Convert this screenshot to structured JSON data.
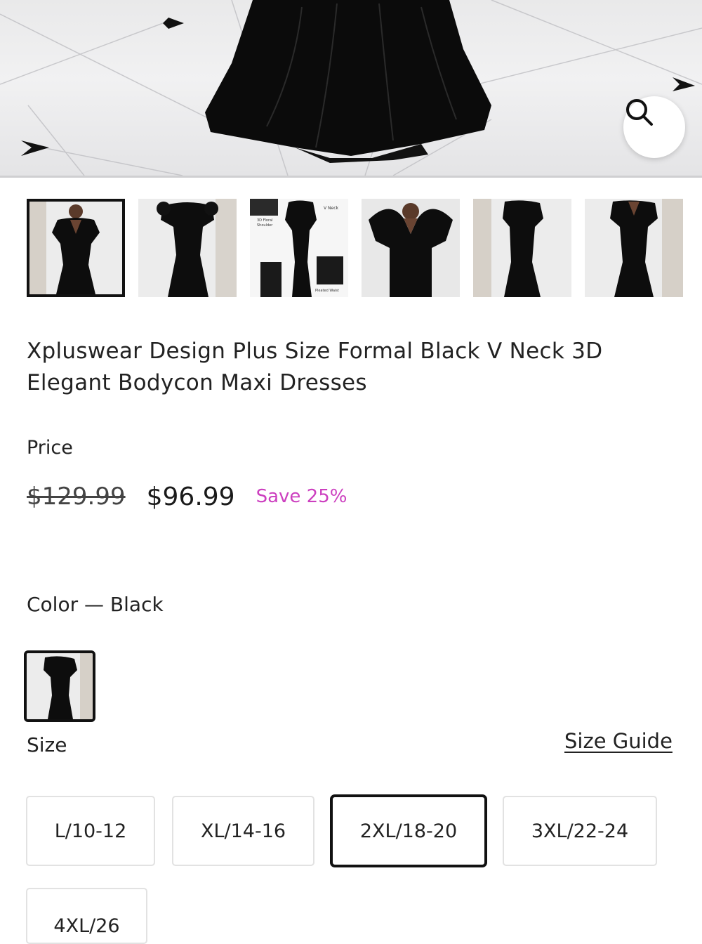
{
  "gallery": {
    "zoom_icon": "magnifier-icon",
    "thumbnails": [
      {
        "id": "front",
        "selected": true,
        "callouts": []
      },
      {
        "id": "back",
        "selected": false,
        "callouts": []
      },
      {
        "id": "details",
        "selected": false,
        "callouts": [
          "V Neck",
          "3D Floral Shoulder",
          "Pleated Waist"
        ]
      },
      {
        "id": "closeup",
        "selected": false,
        "callouts": []
      },
      {
        "id": "side",
        "selected": false,
        "callouts": []
      },
      {
        "id": "front-2",
        "selected": false,
        "callouts": []
      }
    ]
  },
  "product": {
    "title": "Xpluswear Design Plus Size Formal Black V Neck 3D Elegant Bodycon Maxi Dresses",
    "price_label": "Price",
    "original_price": "$129.99",
    "sale_price": "$96.99",
    "save_label": "Save 25%",
    "color_label": "Color",
    "color_separator": " — ",
    "selected_color": "Black",
    "size_label": "Size",
    "size_guide_label": "Size Guide",
    "sizes": [
      {
        "label": "L/10-12",
        "selected": false
      },
      {
        "label": "XL/14-16",
        "selected": false
      },
      {
        "label": "2XL/18-20",
        "selected": true
      },
      {
        "label": "3XL/22-24",
        "selected": false
      },
      {
        "label": "4XL/26",
        "selected": false
      }
    ]
  },
  "colors": {
    "accent": "#cc3fbf",
    "text": "#222222",
    "border": "#e2e2e2",
    "selected_border": "#111111"
  }
}
